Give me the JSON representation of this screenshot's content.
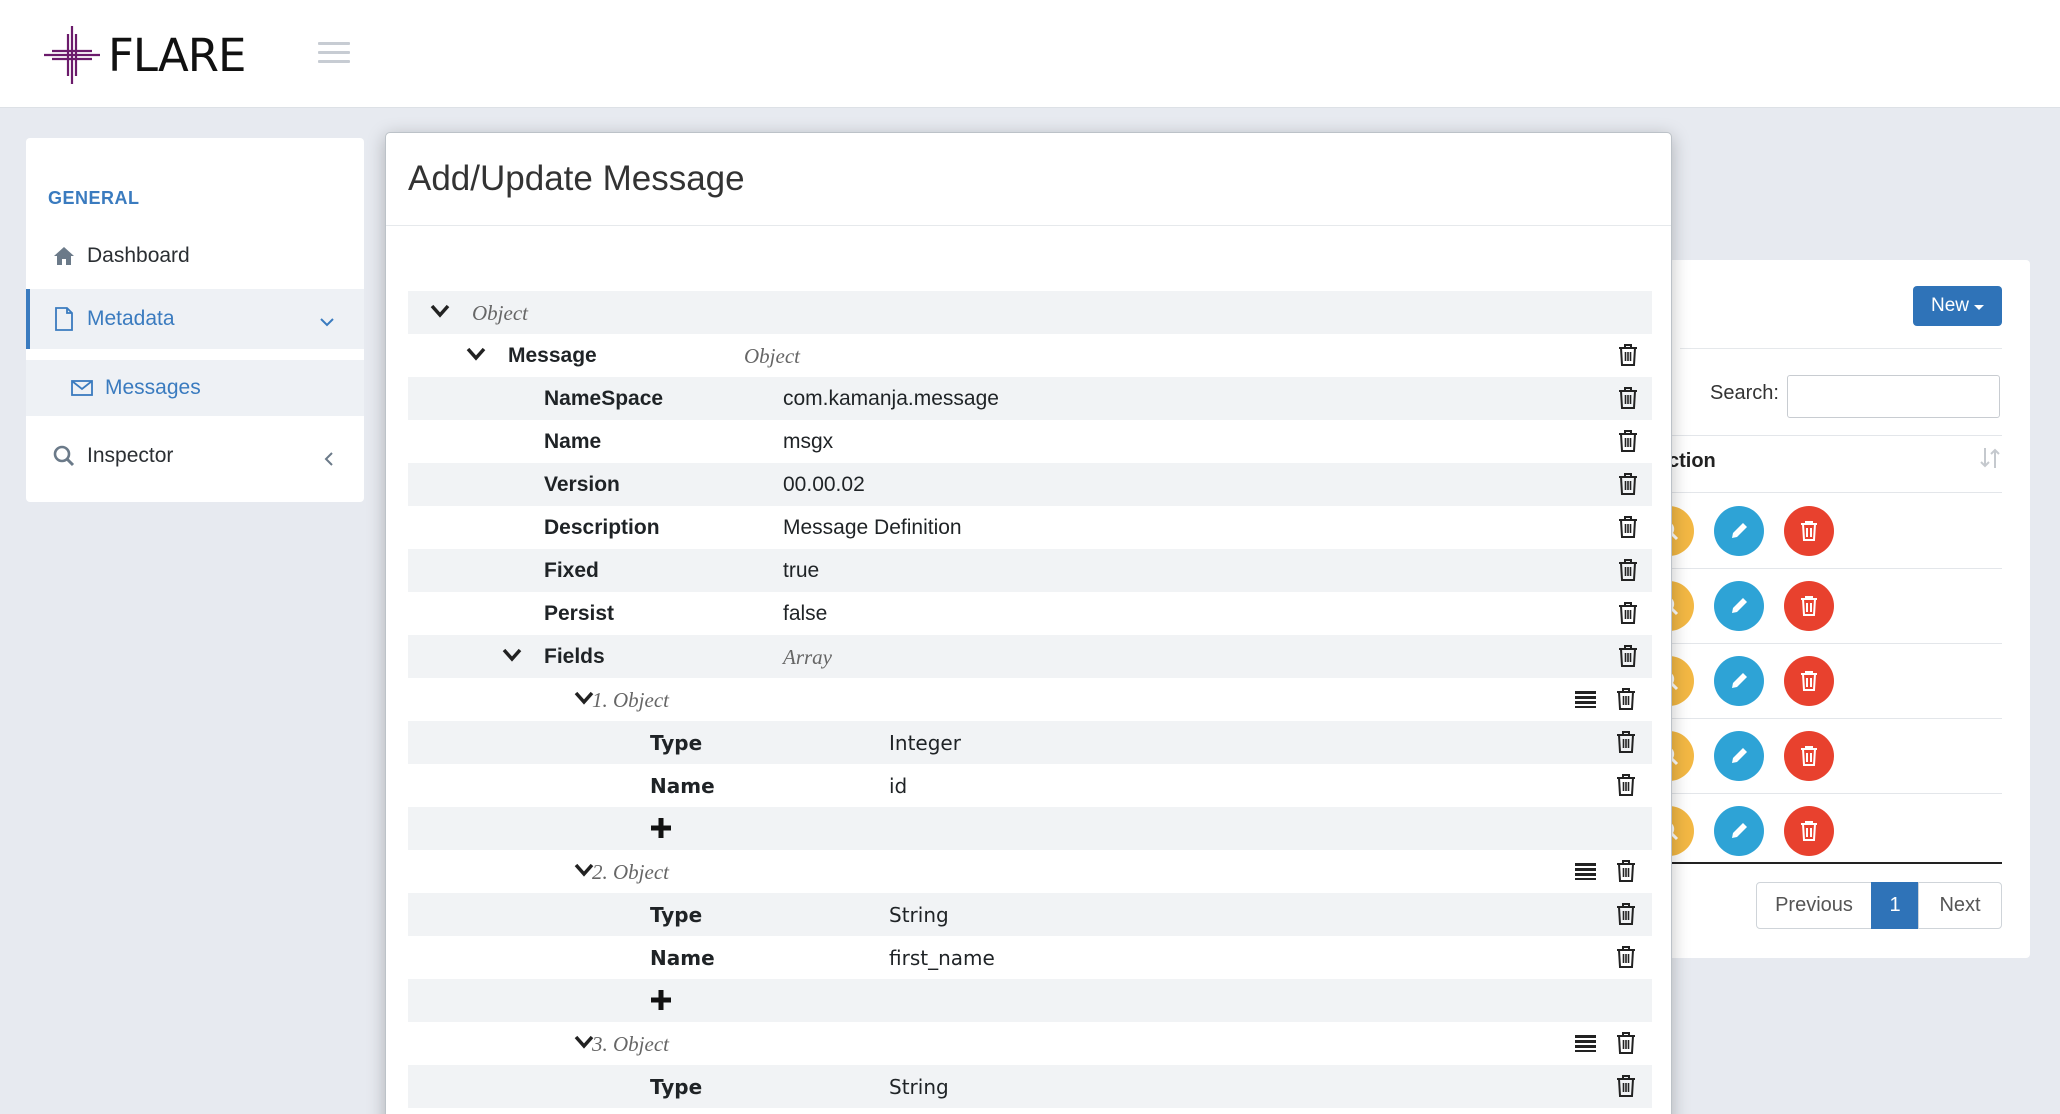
{
  "header": {
    "logo_text": "FLARE"
  },
  "sidebar": {
    "section_title": "GENERAL",
    "items": [
      {
        "label": "Dashboard",
        "icon": "home-icon"
      },
      {
        "label": "Metadata",
        "icon": "document-icon"
      },
      {
        "label": "Messages",
        "icon": "envelope-icon"
      },
      {
        "label": "Inspector",
        "icon": "search-icon"
      }
    ]
  },
  "background_panel": {
    "new_button": "New",
    "search_label": "Search:",
    "search_value": "",
    "column_header": "ction",
    "row_count": 5,
    "pagination": {
      "previous": "Previous",
      "current": "1",
      "next": "Next"
    }
  },
  "modal": {
    "title": "Add/Update Message",
    "root": {
      "type": "Object"
    },
    "message": {
      "key": "Message",
      "type": "Object"
    },
    "properties": [
      {
        "key": "NameSpace",
        "value": "com.kamanja.message"
      },
      {
        "key": "Name",
        "value": "msgx"
      },
      {
        "key": "Version",
        "value": "00.00.02"
      },
      {
        "key": "Description",
        "value": "Message Definition"
      },
      {
        "key": "Fixed",
        "value": "true"
      },
      {
        "key": "Persist",
        "value": "false"
      }
    ],
    "fields": {
      "key": "Fields",
      "type": "Array"
    },
    "field_items": [
      {
        "label": "1.  Object",
        "type_key": "Type",
        "type_value": "Integer",
        "name_key": "Name",
        "name_value": "id"
      },
      {
        "label": "2.  Object",
        "type_key": "Type",
        "type_value": "String",
        "name_key": "Name",
        "name_value": "first_name"
      },
      {
        "label": "3.  Object",
        "type_key": "Type",
        "type_value": "String"
      }
    ]
  },
  "colors": {
    "accent": "#3a7bbf",
    "view": "#f3b844",
    "edit": "#2ea3d6",
    "delete": "#e8412e"
  }
}
